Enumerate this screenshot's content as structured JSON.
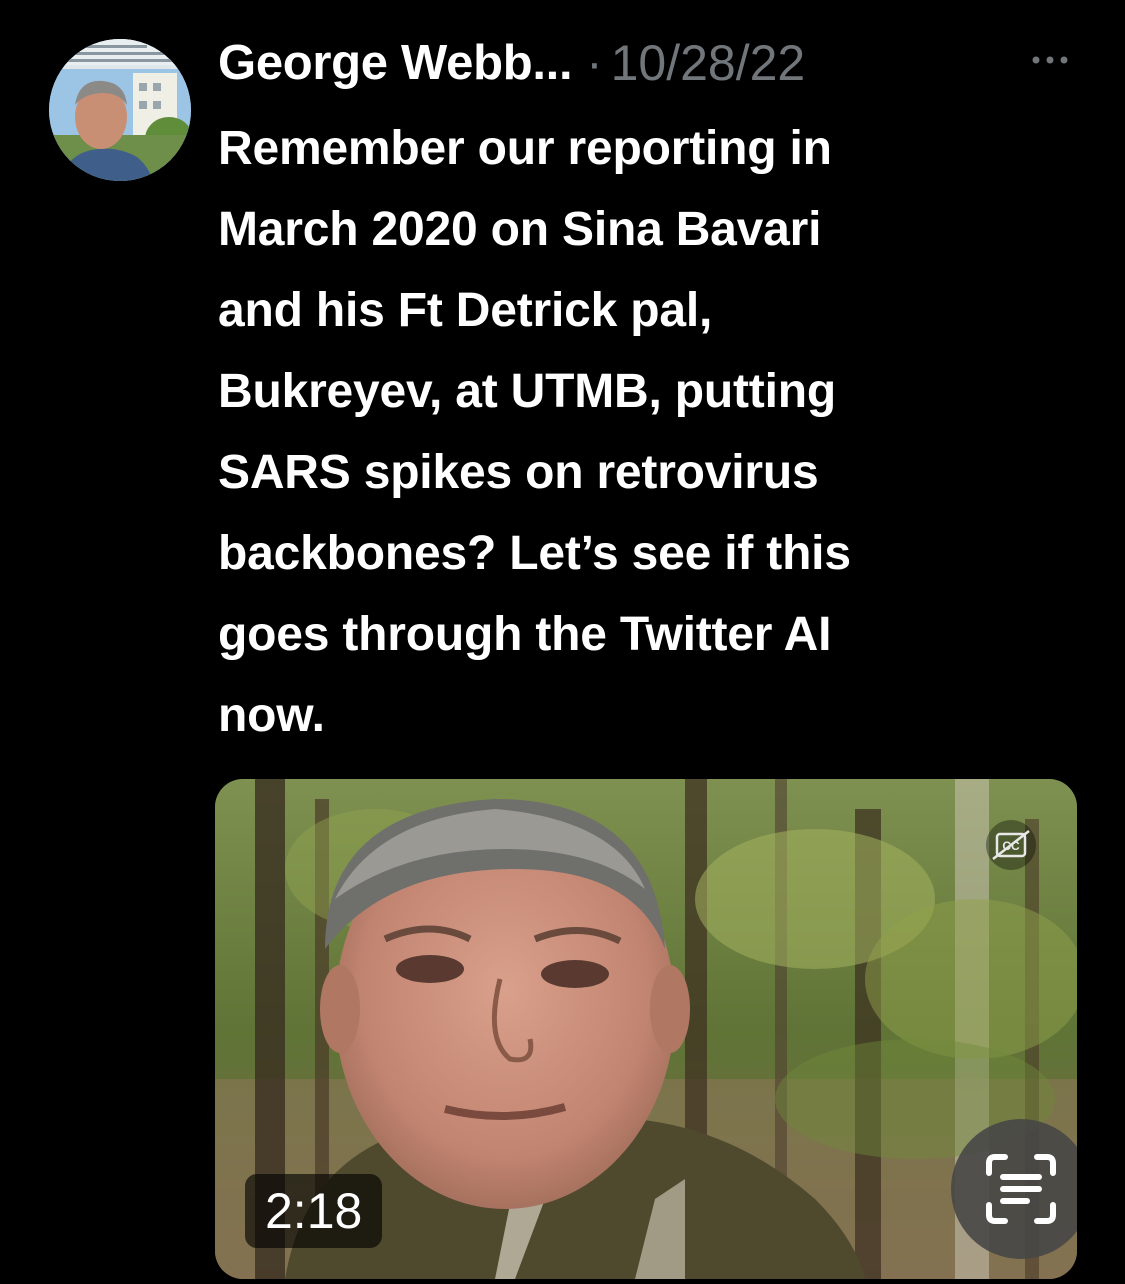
{
  "tweet": {
    "author_name": "George Webb...",
    "separator": "·",
    "timestamp": "10/28/22",
    "text": "Remember our reporting in\nMarch 2020 on Sina Bavari\nand his Ft Detrick pal,\nBukreyev, at UTMB, putting\nSARS spikes on retrovirus\nbackbones?  Let’s see if this\ngoes through the Twitter AI\nnow.",
    "more_icon": "more-horizontal-icon",
    "avatar_icon": "profile-photo"
  },
  "video": {
    "duration": "2:18",
    "caption_icon": "closed-captions-off-icon",
    "scan_icon": "text-recognition-icon"
  },
  "colors": {
    "background": "#000000",
    "text_primary": "#ffffff",
    "text_secondary": "#71767b"
  }
}
